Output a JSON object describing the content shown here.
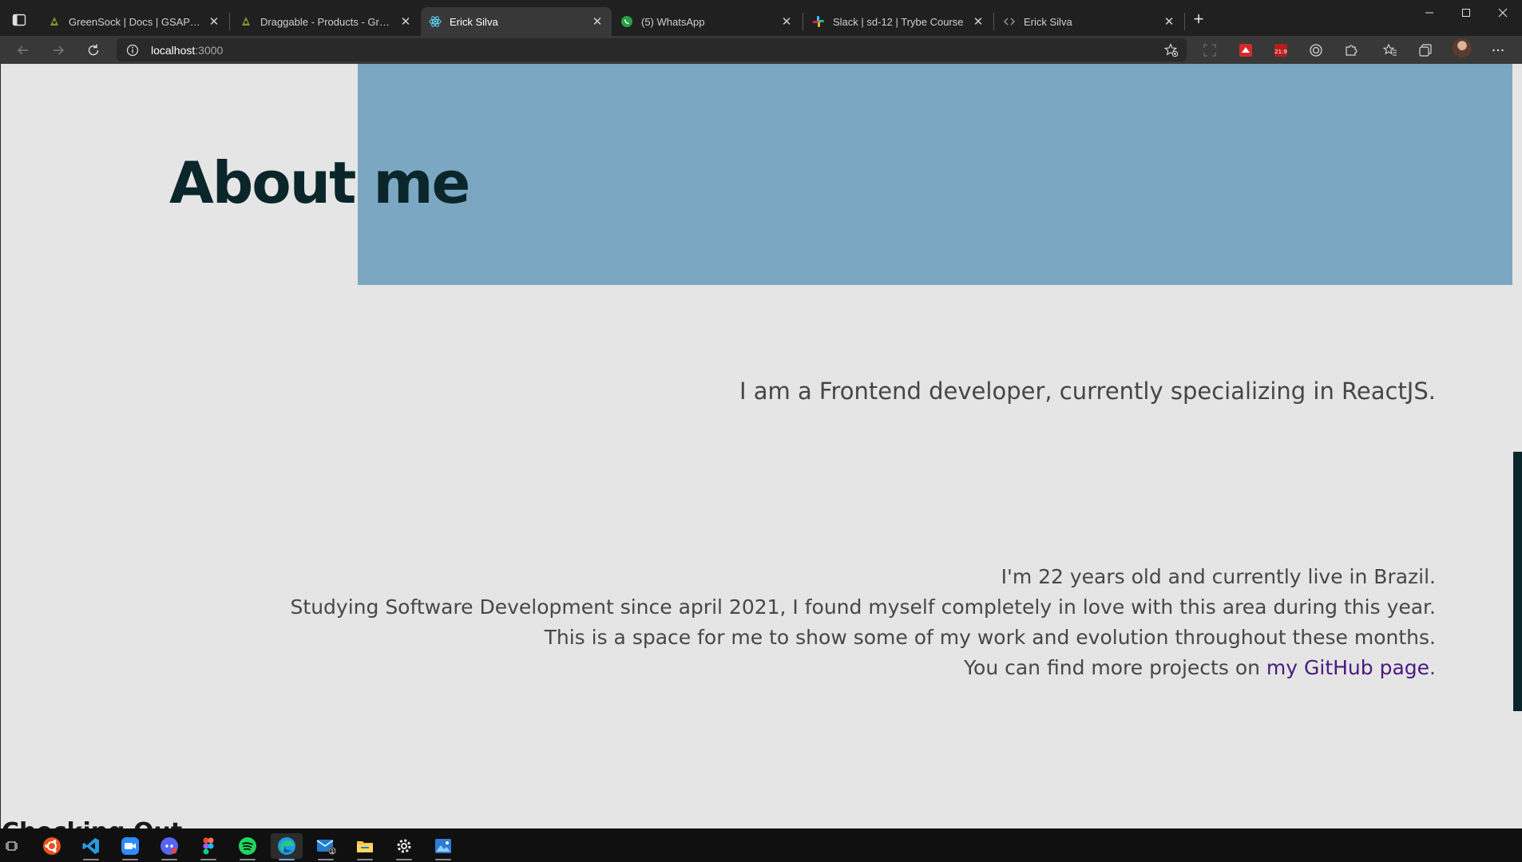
{
  "browser": {
    "tabs": [
      {
        "title": "GreenSock | Docs | GSAP | gsap.to()",
        "icon": "greensock-favicon",
        "active": false
      },
      {
        "title": "Draggable - Products - GreenSock",
        "icon": "greensock-favicon",
        "active": false
      },
      {
        "title": "Erick Silva",
        "icon": "react-favicon",
        "active": true
      },
      {
        "title": "(5) WhatsApp",
        "icon": "whatsapp-favicon",
        "active": false
      },
      {
        "title": "Slack | sd-12 | Trybe Course",
        "icon": "slack-favicon",
        "active": false
      },
      {
        "title": "Erick Silva",
        "icon": "code-favicon",
        "active": false
      }
    ],
    "address": {
      "host": "localhost",
      "port": ":3000"
    },
    "toolbar_icons": [
      "star-add-icon",
      "screenshot-icon",
      "extension-red-icon",
      "extension-badge-icon",
      "circle-icon",
      "puzzle-icon",
      "favorites-icon",
      "collections-icon",
      "profile-avatar",
      "more-icon"
    ]
  },
  "page": {
    "heading": "About me",
    "intro": "I am a Frontend developer, currently specializing in ReactJS.",
    "bio_lines": [
      "I'm 22 years old and currently live in Brazil.",
      "Studying Software Development since april 2021, I found myself completely in love with this area during this year.",
      "This is a space for me to show some of my work and evolution throughout these months."
    ],
    "github_prefix": "You can find more projects on ",
    "github_link": "my GitHub page",
    "github_suffix": ".",
    "next_section": "Checking Out",
    "colors": {
      "accent_block": "#7ba7c2",
      "heading": "#0b262b",
      "link": "#4a1a80",
      "background": "#e5e5e5"
    }
  },
  "taskbar": {
    "items": [
      "task-view-icon",
      "ubuntu-icon",
      "vscode-icon",
      "zoom-icon",
      "discord-icon",
      "figma-icon",
      "spotify-icon",
      "edge-icon",
      "mail-icon",
      "file-explorer-icon",
      "settings-icon",
      "photos-icon"
    ],
    "mail_badge": "1"
  }
}
